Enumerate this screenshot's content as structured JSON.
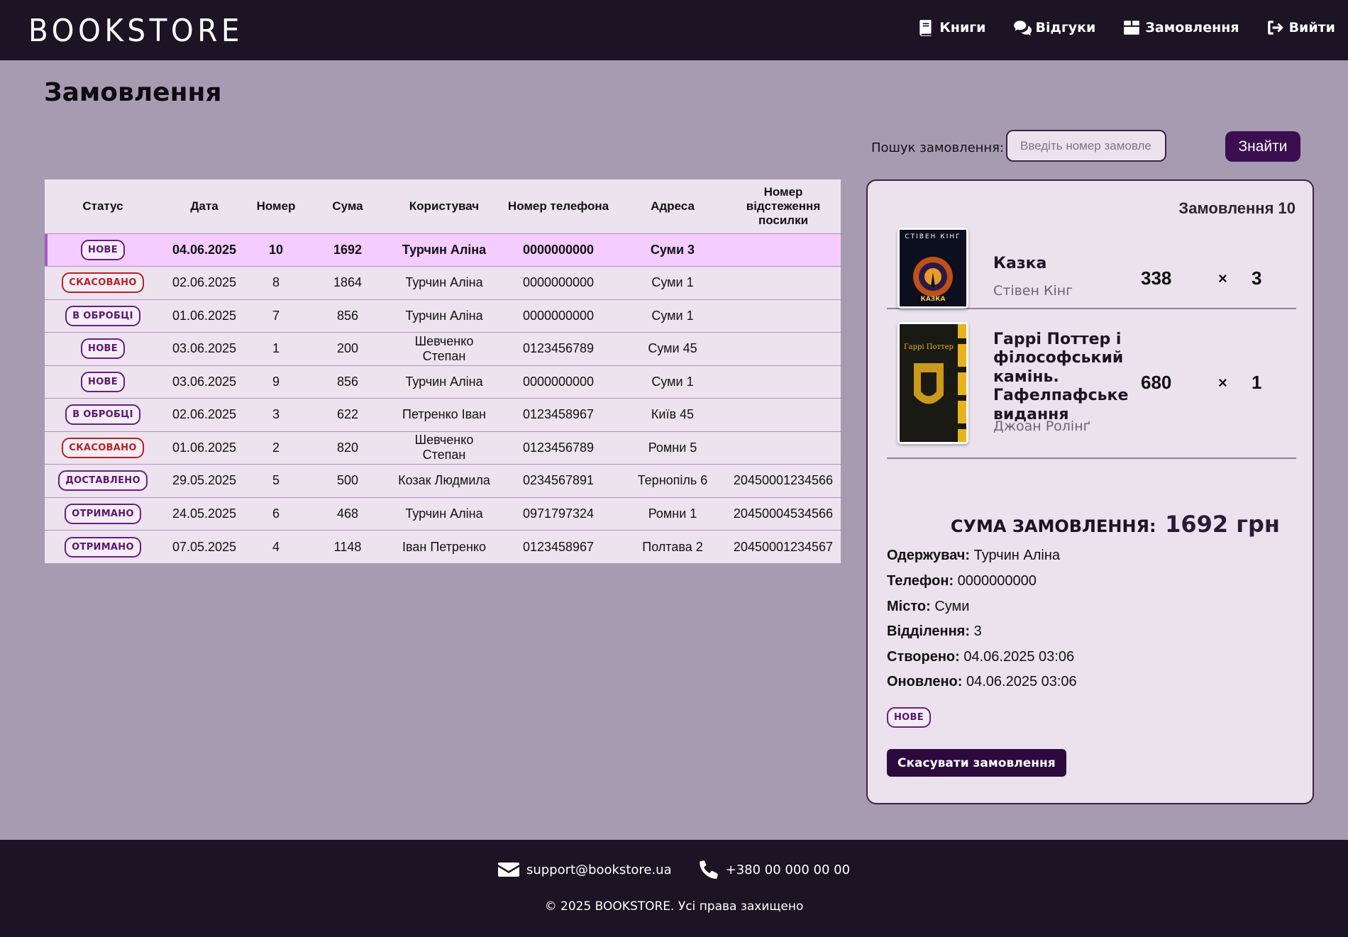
{
  "header": {
    "logo": "BOOKSTORE",
    "nav": [
      {
        "label": "Книги",
        "icon": "book-icon"
      },
      {
        "label": "Відгуки",
        "icon": "comments-icon"
      },
      {
        "label": "Замовлення",
        "icon": "box-icon"
      },
      {
        "label": "Вийти",
        "icon": "logout-icon"
      }
    ]
  },
  "page": {
    "title": "Замовлення"
  },
  "search": {
    "label": "Пошук замовлення:",
    "placeholder": "Введіть номер замовлення",
    "button": "Знайти"
  },
  "table": {
    "columns": [
      "Статус",
      "Дата",
      "Номер",
      "Сума",
      "Користувач",
      "Номер телефона",
      "Адреса",
      "Номер відстеження посилки"
    ],
    "rows": [
      {
        "status": "НОВЕ",
        "date": "04.06.2025",
        "number": "10",
        "sum": "1692",
        "user": "Турчин Аліна",
        "phone": "0000000000",
        "address": "Суми 3",
        "tracking": ""
      },
      {
        "status": "СКАСОВАНО",
        "date": "02.06.2025",
        "number": "8",
        "sum": "1864",
        "user": "Турчин Аліна",
        "phone": "0000000000",
        "address": "Суми 1",
        "tracking": ""
      },
      {
        "status": "В ОБРОБЦІ",
        "date": "01.06.2025",
        "number": "7",
        "sum": "856",
        "user": "Турчин Аліна",
        "phone": "0000000000",
        "address": "Суми 1",
        "tracking": ""
      },
      {
        "status": "НОВЕ",
        "date": "03.06.2025",
        "number": "1",
        "sum": "200",
        "user": "Шевченко Степан",
        "phone": "0123456789",
        "address": "Суми 45",
        "tracking": ""
      },
      {
        "status": "НОВЕ",
        "date": "03.06.2025",
        "number": "9",
        "sum": "856",
        "user": "Турчин Аліна",
        "phone": "0000000000",
        "address": "Суми 1",
        "tracking": ""
      },
      {
        "status": "В ОБРОБЦІ",
        "date": "02.06.2025",
        "number": "3",
        "sum": "622",
        "user": "Петренко Іван",
        "phone": "0123458967",
        "address": "Київ 45",
        "tracking": ""
      },
      {
        "status": "СКАСОВАНО",
        "date": "01.06.2025",
        "number": "2",
        "sum": "820",
        "user": "Шевченко Степан",
        "phone": "0123456789",
        "address": "Ромни 5",
        "tracking": ""
      },
      {
        "status": "ДОСТАВЛЕНО",
        "date": "29.05.2025",
        "number": "5",
        "sum": "500",
        "user": "Козак Людмила",
        "phone": "0234567891",
        "address": "Тернопіль 6",
        "tracking": "20450001234566"
      },
      {
        "status": "ОТРИМАНО",
        "date": "24.05.2025",
        "number": "6",
        "sum": "468",
        "user": "Турчин Аліна",
        "phone": "0971797324",
        "address": "Ромни 1",
        "tracking": "20450004534566"
      },
      {
        "status": "ОТРИМАНО",
        "date": "07.05.2025",
        "number": "4",
        "sum": "1148",
        "user": "Іван Петренко",
        "phone": "0123458967",
        "address": "Полтава 2",
        "tracking": "20450001234567"
      }
    ]
  },
  "detail": {
    "title": "Замовлення 10",
    "items": [
      {
        "title": "Казка",
        "author": "Стівен Кінг",
        "price": "338",
        "times": "×",
        "qty": "3",
        "cover_text": "СТІВЕН КІНГ",
        "cover_subtitle": "КАЗКА"
      },
      {
        "title": "Гаррі Поттер і філософський камінь. Гафелпафське видання",
        "author": "Джоан Ролінґ",
        "price": "680",
        "times": "×",
        "qty": "1",
        "cover_text": "Гаррі Поттер"
      }
    ],
    "total_label": "СУМА ЗАМОВЛЕННЯ:",
    "total_value": "1692 грн",
    "recipient_label": "Одержувач:",
    "recipient": "Турчин Аліна",
    "phone_label": "Телефон:",
    "phone": "0000000000",
    "city_label": "Місто:",
    "city": "Суми",
    "branch_label": "Відділення:",
    "branch": "3",
    "created_label": "Створено:",
    "created": "04.06.2025 03:06",
    "updated_label": "Оновлено:",
    "updated": "04.06.2025 03:06",
    "status": "НОВЕ",
    "cancel_button": "Скасувати замовлення"
  },
  "footer": {
    "email": "support@bookstore.ua",
    "phone": "+380 00 000 00 00",
    "copyright": "© 2025 BOOKSTORE. Усі права захищено"
  },
  "colors": {
    "header_bg": "#1c1424",
    "page_bg": "#a79bb2",
    "accent": "#3b0f4f",
    "selected_row": "#f4ccff",
    "cancel_red": "#b32424"
  }
}
